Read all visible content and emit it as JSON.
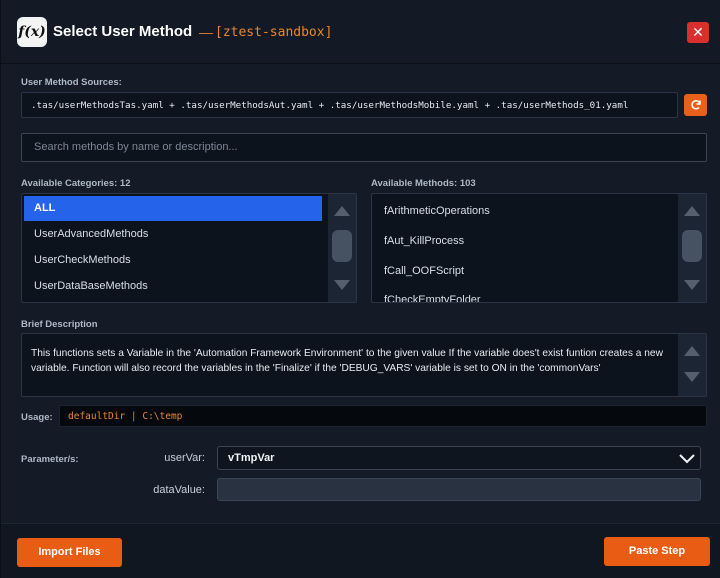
{
  "window": {
    "icon_text": "f(x)",
    "title": "Select User Method",
    "title_separator": "—",
    "environment": "[ztest-sandbox]",
    "close_symbol": "✕"
  },
  "sources": {
    "label": "User Method Sources:",
    "value": ".tas/userMethodsTas.yaml + .tas/userMethodsAut.yaml + .tas/userMethodsMobile.yaml + .tas/userMethods_01.yaml",
    "refresh_icon": "refresh-icon"
  },
  "search": {
    "placeholder": "Search methods by name or description..."
  },
  "categories": {
    "label": "Available Categories: 12",
    "items": [
      "ALL",
      "UserAdvancedMethods",
      "UserCheckMethods",
      "UserDataBaseMethods"
    ],
    "selected": "ALL"
  },
  "methods": {
    "label": "Available Methods: 103",
    "items": [
      "fArithmeticOperations",
      "fAut_KillProcess",
      "fCall_OOFScript",
      "fCheckEmptyFolder"
    ]
  },
  "description": {
    "label": "Brief Description",
    "text": "This functions sets a Variable in the 'Automation Framework Environment' to the given value If the variable does't exist funtion creates a new variable. Function will also record the variables in the 'Finalize' if the 'DEBUG_VARS' variable is set to ON in the 'commonVars'"
  },
  "usage": {
    "label": "Usage:",
    "value": "defaultDir | C:\\temp"
  },
  "parameters": {
    "label": "Parameter/s:",
    "user_var_label": "userVar:",
    "user_var_value": "vTmpVar",
    "data_value_label": "dataValue:",
    "data_value_value": ""
  },
  "footer": {
    "import_label": "Import Files",
    "paste_label": "Paste Step"
  },
  "colors": {
    "accent": "#e85d13",
    "selection": "#2563eb",
    "close": "#d9302e",
    "environment_text": "#e9862d"
  }
}
